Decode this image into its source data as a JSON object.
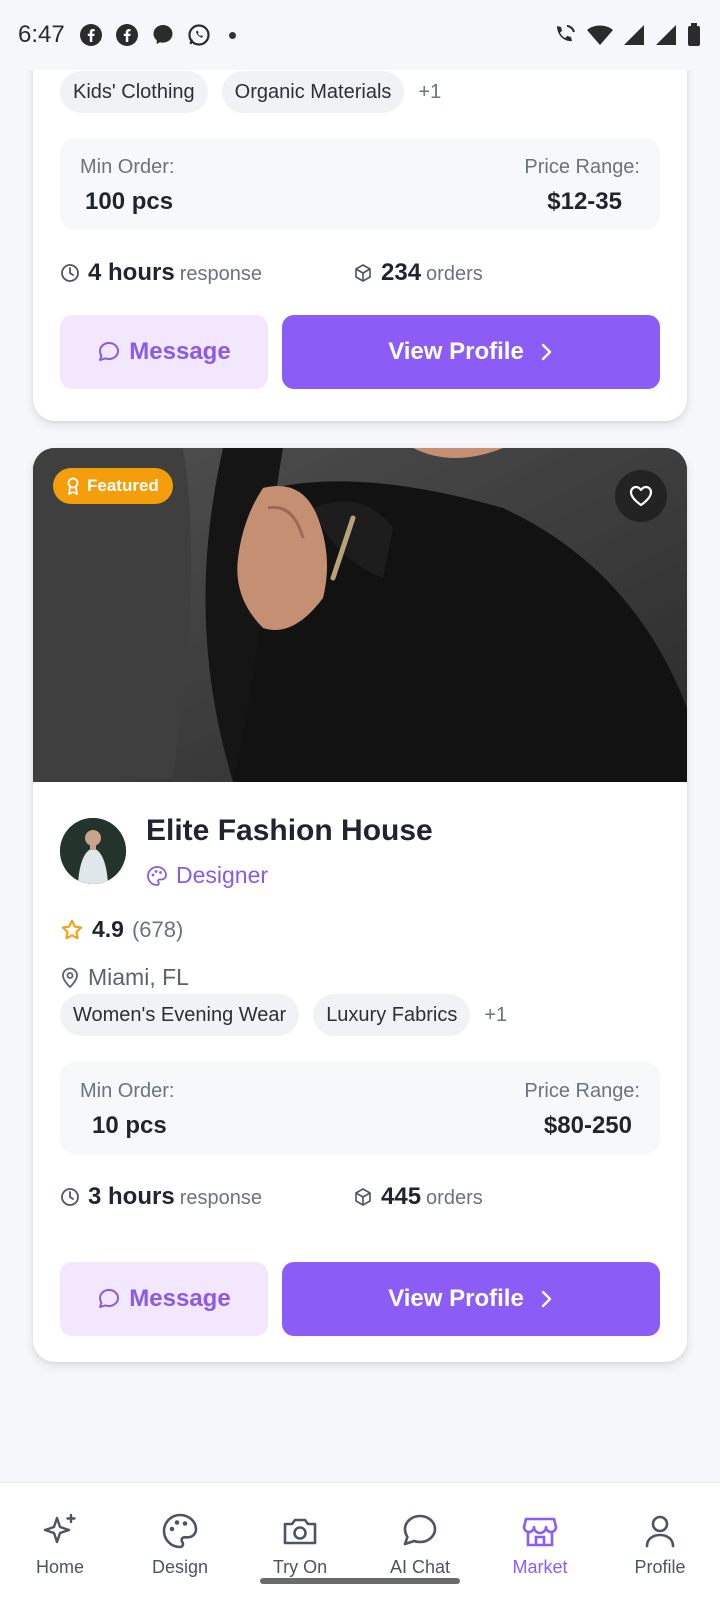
{
  "status_bar": {
    "time": "6:47"
  },
  "card1": {
    "tags": [
      "Kids' Clothing",
      "Organic Materials"
    ],
    "tags_more": "+1",
    "min_order_label": "Min Order:",
    "min_order_value": "100 pcs",
    "price_range_label": "Price Range:",
    "price_range_value": "$12-35",
    "response_value": "4 hours",
    "response_label": "response",
    "orders_value": "234",
    "orders_label": "orders",
    "message_label": "Message",
    "view_profile_label": "View Profile"
  },
  "card2": {
    "featured_label": "Featured",
    "name": "Elite Fashion House",
    "type": "Designer",
    "rating": "4.9",
    "rating_count": "(678)",
    "location": "Miami, FL",
    "tags": [
      "Women's Evening Wear",
      "Luxury Fabrics"
    ],
    "tags_more": "+1",
    "min_order_label": "Min Order:",
    "min_order_value": "10 pcs",
    "price_range_label": "Price Range:",
    "price_range_value": "$80-250",
    "response_value": "3 hours",
    "response_label": "response",
    "orders_value": "445",
    "orders_label": "orders",
    "message_label": "Message",
    "view_profile_label": "View Profile"
  },
  "nav": {
    "items": [
      {
        "label": "Home",
        "icon": "sparkles-icon"
      },
      {
        "label": "Design",
        "icon": "palette-icon"
      },
      {
        "label": "Try On",
        "icon": "camera-icon"
      },
      {
        "label": "AI Chat",
        "icon": "chat-bubble-icon"
      },
      {
        "label": "Market",
        "icon": "store-icon"
      },
      {
        "label": "Profile",
        "icon": "user-icon"
      }
    ],
    "active": "Market"
  },
  "colors": {
    "accent": "#8b5cf6",
    "accent_light": "#f2e7fd",
    "featured": "#f59e0b",
    "star": "#f59e0b"
  }
}
